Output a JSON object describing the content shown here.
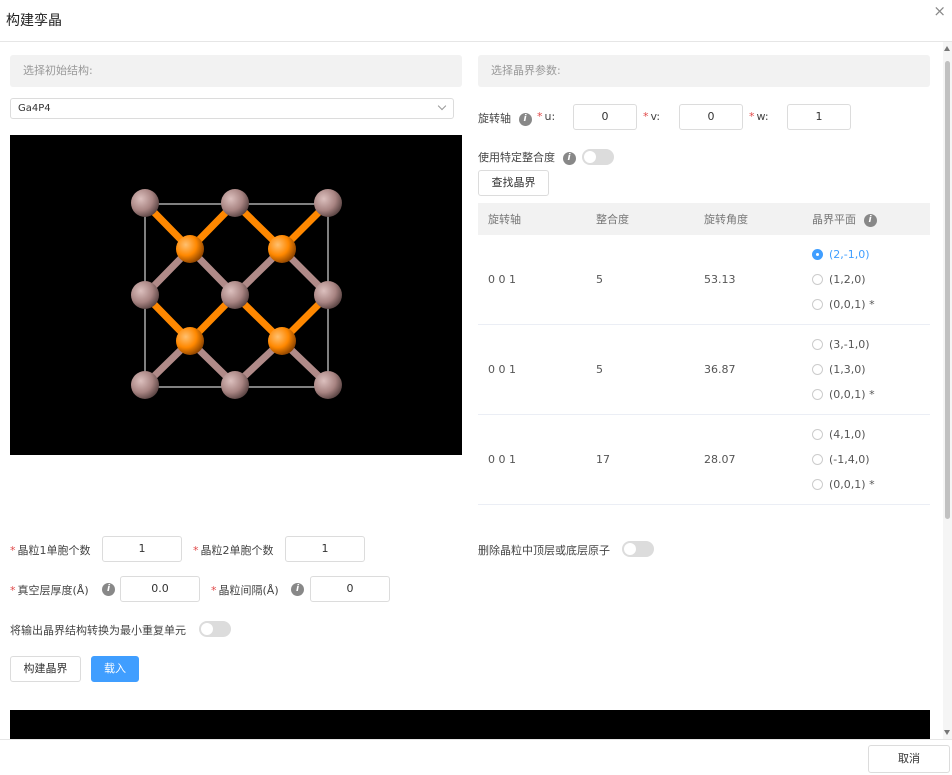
{
  "dialog": {
    "title": "构建孪晶",
    "close_symbol": "×"
  },
  "left": {
    "section_title": "选择初始结构:",
    "structure_select": {
      "value": "Ga4P4"
    }
  },
  "right": {
    "section_title": "选择晶界参数:",
    "axis_label": "旋转轴",
    "u_label": "u:",
    "v_label": "v:",
    "w_label": "w:",
    "u": "0",
    "v": "0",
    "w": "1",
    "specific_sigma_label": "使用特定整合度",
    "find_button": "查找晶界",
    "table": {
      "headers": [
        "旋转轴",
        "整合度",
        "旋转角度",
        "晶界平面"
      ],
      "rows": [
        {
          "axis": "0 0 1",
          "sigma": "5",
          "angle": "53.13",
          "planes": [
            "(2,-1,0)",
            "(1,2,0)",
            "(0,0,1) *"
          ],
          "selected": 0
        },
        {
          "axis": "0 0 1",
          "sigma": "5",
          "angle": "36.87",
          "planes": [
            "(3,-1,0)",
            "(1,3,0)",
            "(0,0,1) *"
          ],
          "selected": -1
        },
        {
          "axis": "0 0 1",
          "sigma": "17",
          "angle": "28.07",
          "planes": [
            "(4,1,0)",
            "(-1,4,0)",
            "(0,0,1) *"
          ],
          "selected": -1
        }
      ]
    },
    "delete_atoms_label": "删除晶粒中顶层或底层原子"
  },
  "form": {
    "grain1_label": "晶粒1单胞个数",
    "grain1_value": "1",
    "grain2_label": "晶粒2单胞个数",
    "grain2_value": "1",
    "vacuum_label": "真空层厚度(Å)",
    "vacuum_value": "0.0",
    "gap_label": "晶粒间隔(Å)",
    "gap_value": "0",
    "convert_label": "将输出晶界结构转换为最小重复单元"
  },
  "buttons": {
    "build": "构建晶界",
    "load": "载入",
    "cancel": "取消"
  },
  "colors": {
    "primary": "#409eff",
    "gallium": "#b08a88",
    "phosphorus": "#ff8800",
    "required": "#e04848"
  },
  "icons": {
    "info": "info-icon",
    "chevron": "chevron-down-icon"
  }
}
